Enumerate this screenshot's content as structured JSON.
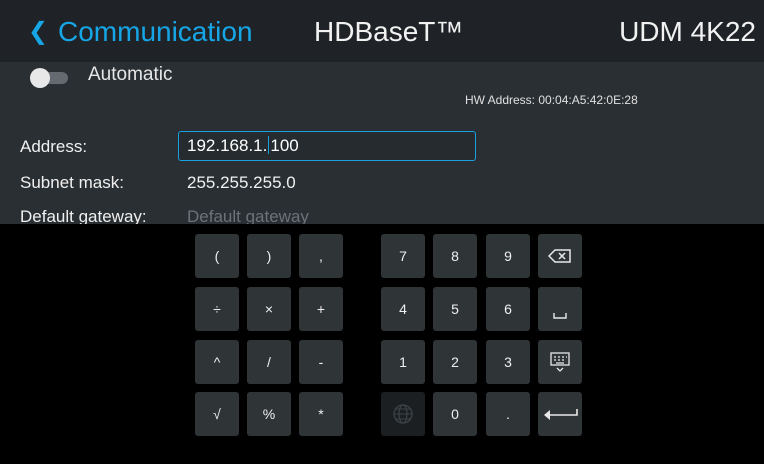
{
  "header": {
    "back_icon": "chevron-left-icon",
    "title": "Communication",
    "section": "HDBaseT™",
    "model": "UDM 4K22",
    "accent_color": "#16a6e6"
  },
  "settings": {
    "automatic_label": "Automatic",
    "automatic_enabled": false,
    "hw_address": "HW Address: 00:04:A5:42:0E:28",
    "address_label": "Address:",
    "address_value_before_cursor": "192.168.1.",
    "address_value_after_cursor": "100",
    "subnet_label": "Subnet mask:",
    "subnet_value": "255.255.255.0",
    "gateway_label": "Default gateway:",
    "gateway_placeholder": "Default gateway"
  },
  "keyboard": {
    "symbols": [
      "(",
      ")",
      ",",
      "÷",
      "×",
      "+",
      "^",
      "/",
      "-",
      "√",
      "%",
      "*"
    ],
    "digits": [
      "7",
      "8",
      "9",
      "4",
      "5",
      "6",
      "1",
      "2",
      "3",
      "0",
      "."
    ],
    "icons": [
      "backspace-icon",
      "space-icon",
      "keyboard-hide-icon",
      "globe-icon",
      "enter-icon"
    ]
  }
}
